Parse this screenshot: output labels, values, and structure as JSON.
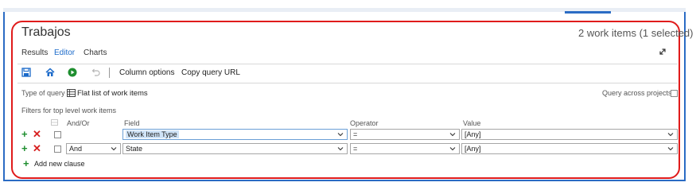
{
  "header": {
    "title": "Trabajos",
    "count_text": "2 work items (1 selected)"
  },
  "tabs": [
    {
      "label": "Results"
    },
    {
      "label": "Editor"
    },
    {
      "label": "Charts"
    }
  ],
  "toolbar": {
    "column_options": "Column options",
    "copy_query_url": "Copy query URL"
  },
  "query": {
    "type_label": "Type of query",
    "type_value": "Flat list of work items",
    "across_projects_label": "Query across projects",
    "filters_label": "Filters for top level work items"
  },
  "columns": {
    "and_or": "And/Or",
    "field": "Field",
    "operator": "Operator",
    "value": "Value"
  },
  "clauses": [
    {
      "and_or": "",
      "field": "Work Item Type",
      "operator": "=",
      "value": "[Any]"
    },
    {
      "and_or": "And",
      "field": "State",
      "operator": "=",
      "value": "[Any]"
    }
  ],
  "add_clause_label": "Add new clause",
  "colors": {
    "accent": "#1b6ac9",
    "highlight": "#e01b1b",
    "add": "#1e8e2f",
    "remove": "#d71f1f"
  }
}
